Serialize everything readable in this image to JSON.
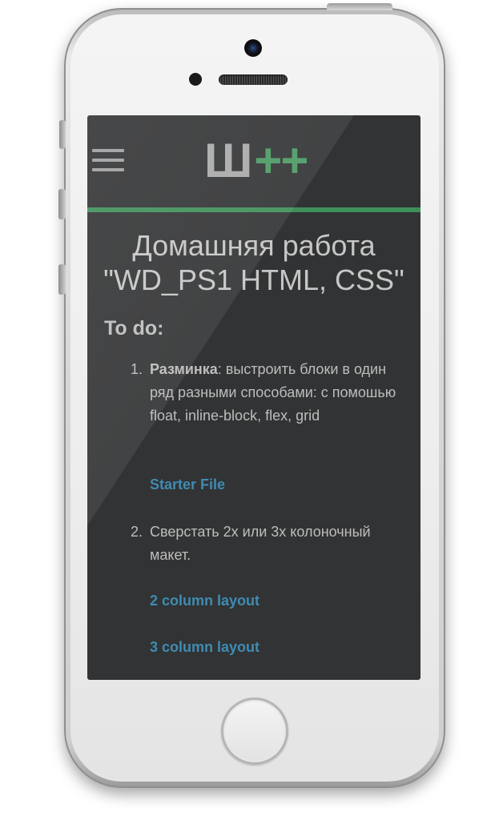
{
  "logo": {
    "letter": "Ш",
    "plus": "++"
  },
  "page_title_line1": "Домашняя работа",
  "page_title_line2": "\"WD_PS1 HTML, CSS\"",
  "todo_heading": "To do:",
  "items": [
    {
      "number": "1.",
      "bold": "Разминка",
      "text": ": выстроить блоки в один ряд разными способами: с помошью float, inline-block, flex, grid",
      "links": [
        "Starter File"
      ]
    },
    {
      "number": "2.",
      "bold": "",
      "text": "Сверстать 2х или 3х колоночный макет.",
      "links": [
        "2 column layout",
        "3 column layout"
      ]
    }
  ],
  "colors": {
    "accent_green": "#3f8f5a",
    "link": "#3e8cb3",
    "background": "#323334"
  },
  "icons": [
    "hamburger-menu-icon",
    "home-button"
  ]
}
